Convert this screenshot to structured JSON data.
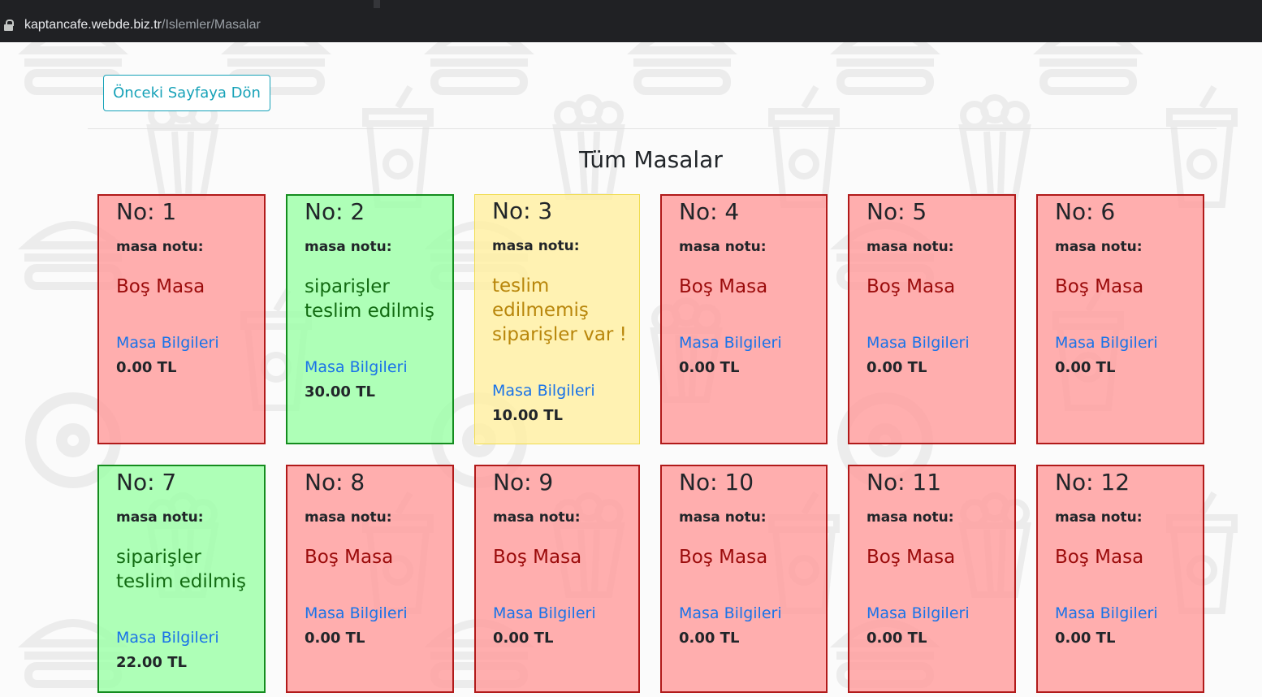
{
  "browser": {
    "url_host": "kaptancafe.webde.biz.tr",
    "url_path": "/Islemler/Masalar"
  },
  "back_button": "Önceki Sayfaya Dön",
  "title": "Tüm Masalar",
  "note_label": "masa notu:",
  "info_label": "Masa Bilgileri",
  "tables": [
    {
      "no": "No: 1",
      "status": "Boş Masa",
      "total": "0.00 TL",
      "state": "empty"
    },
    {
      "no": "No: 2",
      "status": "siparişler teslim edilmiş",
      "total": "30.00 TL",
      "state": "delivered"
    },
    {
      "no": "No: 3",
      "status": "teslim edilmemiş siparişler var !",
      "total": "10.00 TL",
      "state": "pending"
    },
    {
      "no": "No: 4",
      "status": "Boş Masa",
      "total": "0.00 TL",
      "state": "empty"
    },
    {
      "no": "No: 5",
      "status": "Boş Masa",
      "total": "0.00 TL",
      "state": "empty"
    },
    {
      "no": "No: 6",
      "status": "Boş Masa",
      "total": "0.00 TL",
      "state": "empty"
    },
    {
      "no": "No: 7",
      "status": "siparişler teslim edilmiş",
      "total": "22.00 TL",
      "state": "delivered"
    },
    {
      "no": "No: 8",
      "status": "Boş Masa",
      "total": "0.00 TL",
      "state": "empty"
    },
    {
      "no": "No: 9",
      "status": "Boş Masa",
      "total": "0.00 TL",
      "state": "empty"
    },
    {
      "no": "No: 10",
      "status": "Boş Masa",
      "total": "0.00 TL",
      "state": "empty"
    },
    {
      "no": "No: 11",
      "status": "Boş Masa",
      "total": "0.00 TL",
      "state": "empty"
    },
    {
      "no": "No: 12",
      "status": "Boş Masa",
      "total": "0.00 TL",
      "state": "empty"
    }
  ],
  "colors": {
    "empty": "#ffa0a0",
    "delivered": "#a0ffaa",
    "pending": "#fff0a5",
    "accent": "#17a2b8",
    "link": "#1a73e8"
  }
}
